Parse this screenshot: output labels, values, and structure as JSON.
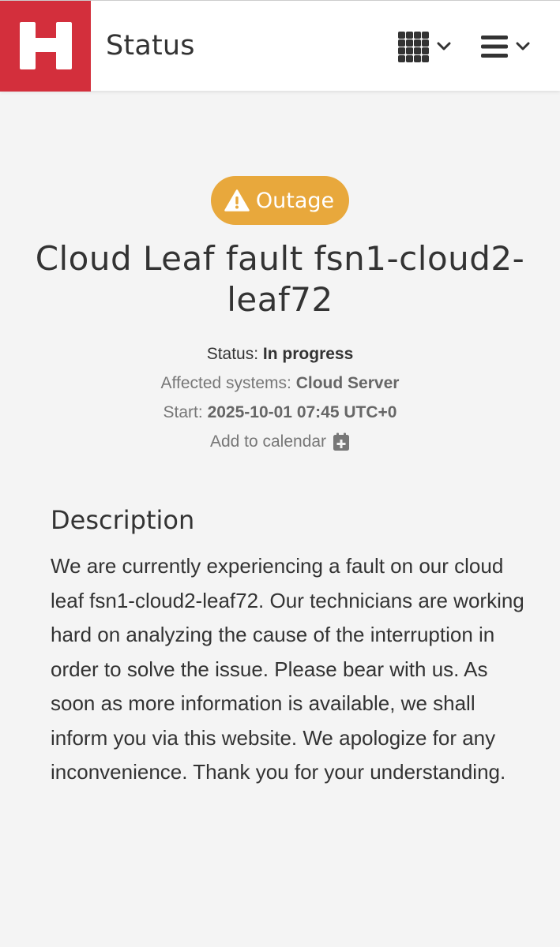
{
  "header": {
    "logo_letter": "H",
    "title": "Status",
    "brand_color": "#d32f3c",
    "apps_menu_icon": "grid-icon",
    "main_menu_icon": "hamburger-icon"
  },
  "incident": {
    "badge_label": "Outage",
    "badge_color": "#e8a83c",
    "title": "Cloud Leaf fault fsn1-cloud2-leaf72",
    "status_label": "Status:",
    "status_value": "In progress",
    "affected_label": "Affected systems:",
    "affected_value": "Cloud Server",
    "start_label": "Start:",
    "start_value": "2025-10-01 07:45 UTC+0",
    "calendar_label": "Add to calendar"
  },
  "description": {
    "heading": "Description",
    "body": "We are currently experiencing a fault on our cloud leaf fsn1-cloud2-leaf72. Our technicians are working hard on analyzing the cause of the interruption in order to solve the issue. Please bear with us. As soon as more information is available, we shall inform you via this website. We apologize for any inconvenience. Thank you for your understanding."
  }
}
